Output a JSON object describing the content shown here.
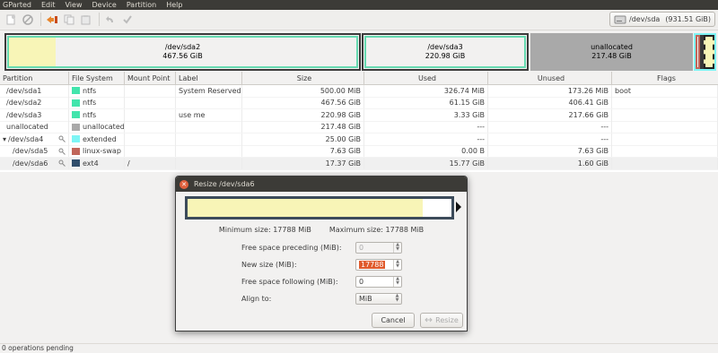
{
  "menubar": {
    "items": [
      "GParted",
      "Edit",
      "View",
      "Device",
      "Partition",
      "Help"
    ]
  },
  "toolbar": {
    "icons": [
      "new-icon",
      "delete-icon",
      "resize-move-icon",
      "copy-icon",
      "paste-icon",
      "undo-icon",
      "apply-icon"
    ]
  },
  "device": {
    "name": "/dev/sda",
    "size": "(931.51 GiB)"
  },
  "viz": {
    "sda2": {
      "name": "/dev/sda2",
      "size": "467.56 GiB"
    },
    "sda3": {
      "name": "/dev/sda3",
      "size": "220.98 GiB"
    },
    "unalloc": {
      "name": "unallocated",
      "size": "217.48 GiB"
    }
  },
  "columns": [
    "Partition",
    "File System",
    "Mount Point",
    "Label",
    "Size",
    "Used",
    "Unused",
    "Flags"
  ],
  "rows": [
    {
      "partition": "/dev/sda1",
      "fs": "ntfs",
      "fscolor": "#42e5ac",
      "mount": "",
      "label": "System Reserved",
      "size": "500.00 MiB",
      "used": "326.74 MiB",
      "unused": "173.26 MiB",
      "flags": "boot"
    },
    {
      "partition": "/dev/sda2",
      "fs": "ntfs",
      "fscolor": "#42e5ac",
      "mount": "",
      "label": "",
      "size": "467.56 GiB",
      "used": "61.15 GiB",
      "unused": "406.41 GiB",
      "flags": ""
    },
    {
      "partition": "/dev/sda3",
      "fs": "ntfs",
      "fscolor": "#42e5ac",
      "mount": "",
      "label": "use me",
      "size": "220.98 GiB",
      "used": "3.33 GiB",
      "unused": "217.66 GiB",
      "flags": ""
    },
    {
      "partition": "unallocated",
      "fs": "unallocated",
      "fscolor": "#a9a9a9",
      "mount": "",
      "label": "",
      "size": "217.48 GiB",
      "used": "---",
      "unused": "---",
      "flags": ""
    },
    {
      "partition": "/dev/sda4",
      "fs": "extended",
      "fscolor": "#7df5f5",
      "mount": "",
      "label": "",
      "size": "25.00 GiB",
      "used": "---",
      "unused": "---",
      "flags": ""
    },
    {
      "partition": "/dev/sda5",
      "fs": "linux-swap",
      "fscolor": "#c1665a",
      "mount": "",
      "label": "",
      "size": "7.63 GiB",
      "used": "0.00 B",
      "unused": "7.63 GiB",
      "flags": ""
    },
    {
      "partition": "/dev/sda6",
      "fs": "ext4",
      "fscolor": "#314e6c",
      "mount": "/",
      "label": "",
      "size": "17.37 GiB",
      "used": "15.77 GiB",
      "unused": "1.60 GiB",
      "flags": ""
    }
  ],
  "status": "0 operations pending",
  "dialog": {
    "title": "Resize /dev/sda6",
    "fill_fraction": 0.89,
    "min_size": "Minimum size: 17788 MiB",
    "max_size": "Maximum size: 17788 MiB",
    "preceding_label": "Free space preceding (MiB):",
    "preceding_value": "0",
    "newsize_label": "New size (MiB):",
    "newsize_value": "17788",
    "following_label": "Free space following (MiB):",
    "following_value": "0",
    "align_label": "Align to:",
    "align_value": "MiB",
    "cancel": "Cancel",
    "resize": "Resize"
  }
}
